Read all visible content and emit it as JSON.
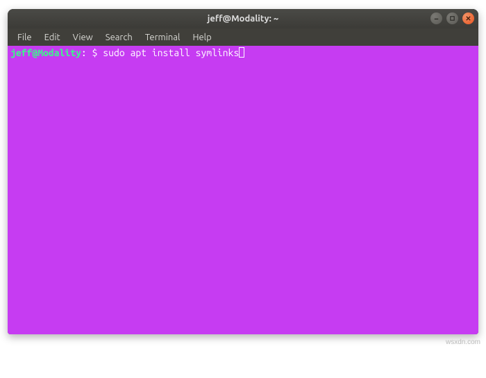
{
  "window": {
    "title": "jeff@Modality: ~"
  },
  "menubar": {
    "items": [
      {
        "label": "File"
      },
      {
        "label": "Edit"
      },
      {
        "label": "View"
      },
      {
        "label": "Search"
      },
      {
        "label": "Terminal"
      },
      {
        "label": "Help"
      }
    ]
  },
  "terminal": {
    "prompt_user_host": "jeff@Modality",
    "prompt_colon": ":",
    "prompt_path": " ",
    "prompt_symbol": "$ ",
    "command": "sudo apt install symlinks"
  },
  "watermark": "wsxdn.com"
}
